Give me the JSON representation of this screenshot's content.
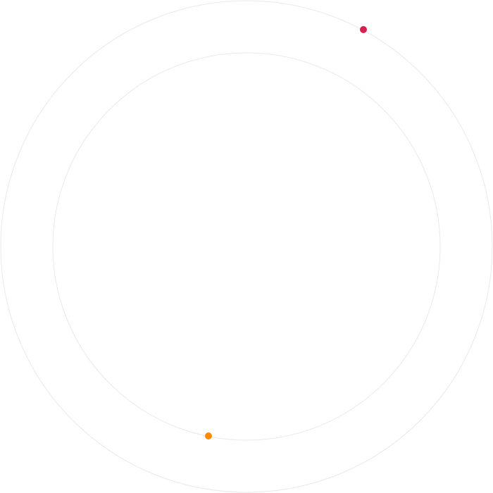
{
  "colors": {
    "background": "#ffffff",
    "ring_stroke": "#e9e9e9",
    "outer_dot": "#d81f4f",
    "inner_dot": "#ff8a00"
  },
  "orbits": [
    {
      "id": "outer",
      "dot_color_key": "outer_dot"
    },
    {
      "id": "inner",
      "dot_color_key": "inner_dot"
    }
  ]
}
